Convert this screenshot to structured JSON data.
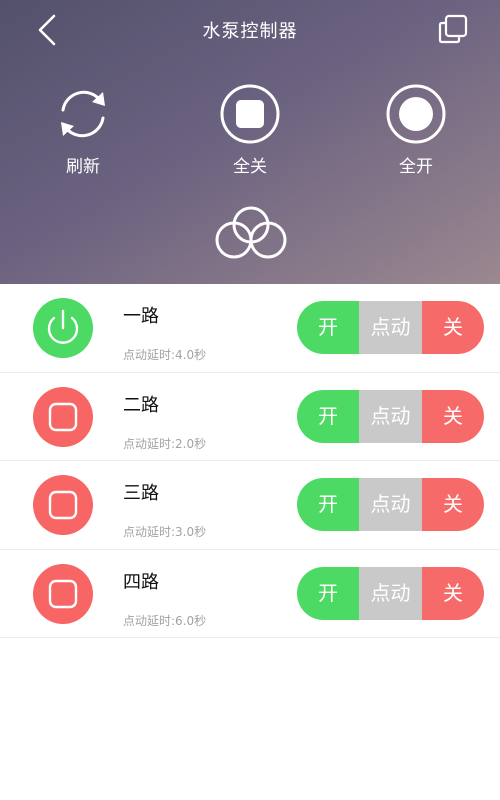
{
  "header": {
    "title": "水泵控制器",
    "back_icon": "chevron-left-icon",
    "copy_icon": "copy-icon"
  },
  "actions": [
    {
      "label": "刷新",
      "icon": "refresh-icon"
    },
    {
      "label": "全关",
      "icon": "stop-square-icon"
    },
    {
      "label": "全开",
      "icon": "record-circle-icon"
    }
  ],
  "cloud_icon": "cloud-icon",
  "colors": {
    "on": "#4cd964",
    "off": "#f76565",
    "jog": "#c9c9c9",
    "header_start": "#53516c",
    "header_end": "#9b8890"
  },
  "channels": [
    {
      "name": "一路",
      "delay": "点动延时:4.0秒",
      "state": "on",
      "btn_on": "开",
      "btn_jog": "点动",
      "btn_off": "关"
    },
    {
      "name": "二路",
      "delay": "点动延时:2.0秒",
      "state": "off",
      "btn_on": "开",
      "btn_jog": "点动",
      "btn_off": "关"
    },
    {
      "name": "三路",
      "delay": "点动延时:3.0秒",
      "state": "off",
      "btn_on": "开",
      "btn_jog": "点动",
      "btn_off": "关"
    },
    {
      "name": "四路",
      "delay": "点动延时:6.0秒",
      "state": "off",
      "btn_on": "开",
      "btn_jog": "点动",
      "btn_off": "关"
    }
  ]
}
